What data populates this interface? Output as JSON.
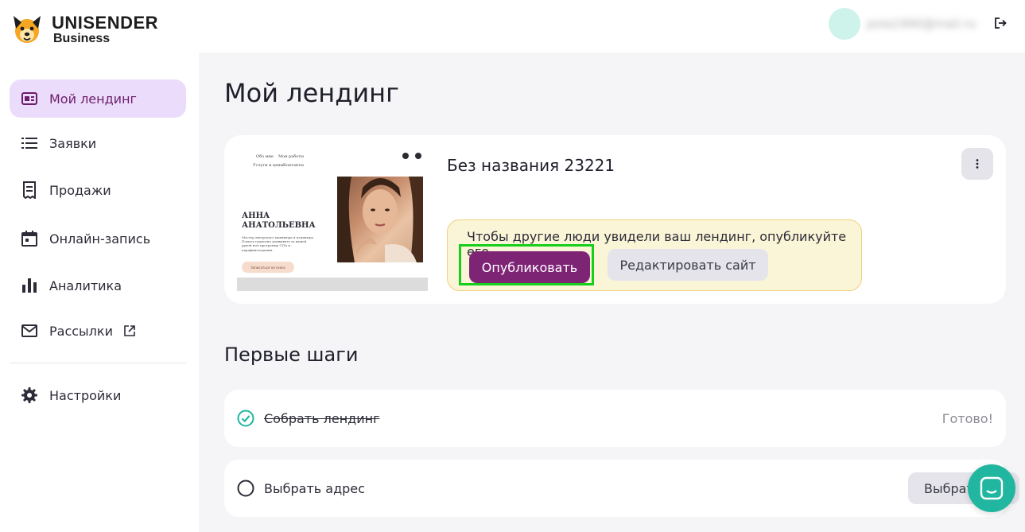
{
  "header": {
    "brand_line1": "UNISENDER",
    "brand_line2": "Business",
    "user_email": "pola1990@mail.ru"
  },
  "sidebar": {
    "items": [
      {
        "label": "Мой лендинг",
        "icon": "landing-icon",
        "active": true
      },
      {
        "label": "Заявки",
        "icon": "list-icon"
      },
      {
        "label": "Продажи",
        "icon": "receipt-icon"
      },
      {
        "label": "Онлайн-запись",
        "icon": "calendar-icon"
      },
      {
        "label": "Аналитика",
        "icon": "bar-chart-icon"
      },
      {
        "label": "Рассылки",
        "icon": "mail-icon",
        "external": true
      },
      {
        "label": "Настройки",
        "icon": "gear-icon"
      }
    ]
  },
  "main": {
    "title": "Мой лендинг",
    "landing": {
      "name": "Без названия 23221",
      "preview": {
        "nav": [
          "Обо мне",
          "Мои работы",
          "Услуги и цены",
          "Контакты"
        ],
        "person_name_line1": "АННА",
        "person_name_line2": "АНАТОЛЬЕВНА",
        "description": "Мастер авторского маникюра и педикюра. Помогу грамотно ухаживать за вашей рукой всю программу СПА и парафинотерапии.",
        "cta": "Записаться на сеанс"
      },
      "banner_text": "Чтобы другие люди увидели ваш лендинг, опубликуйте его",
      "publish_label": "Опубликовать",
      "edit_label": "Редактировать сайт"
    },
    "steps_title": "Первые шаги",
    "steps": [
      {
        "label": "Собрать лендинг",
        "done": true,
        "status": "Готово!"
      },
      {
        "label": "Выбрать адрес",
        "done": false,
        "action": "Выбрать"
      }
    ]
  },
  "colors": {
    "accent": "#7d2475",
    "active_bg": "#ecdcfb",
    "done_check": "#20b6a0",
    "highlight": "#16cf1a",
    "banner_bg": "#fbf5d7"
  }
}
